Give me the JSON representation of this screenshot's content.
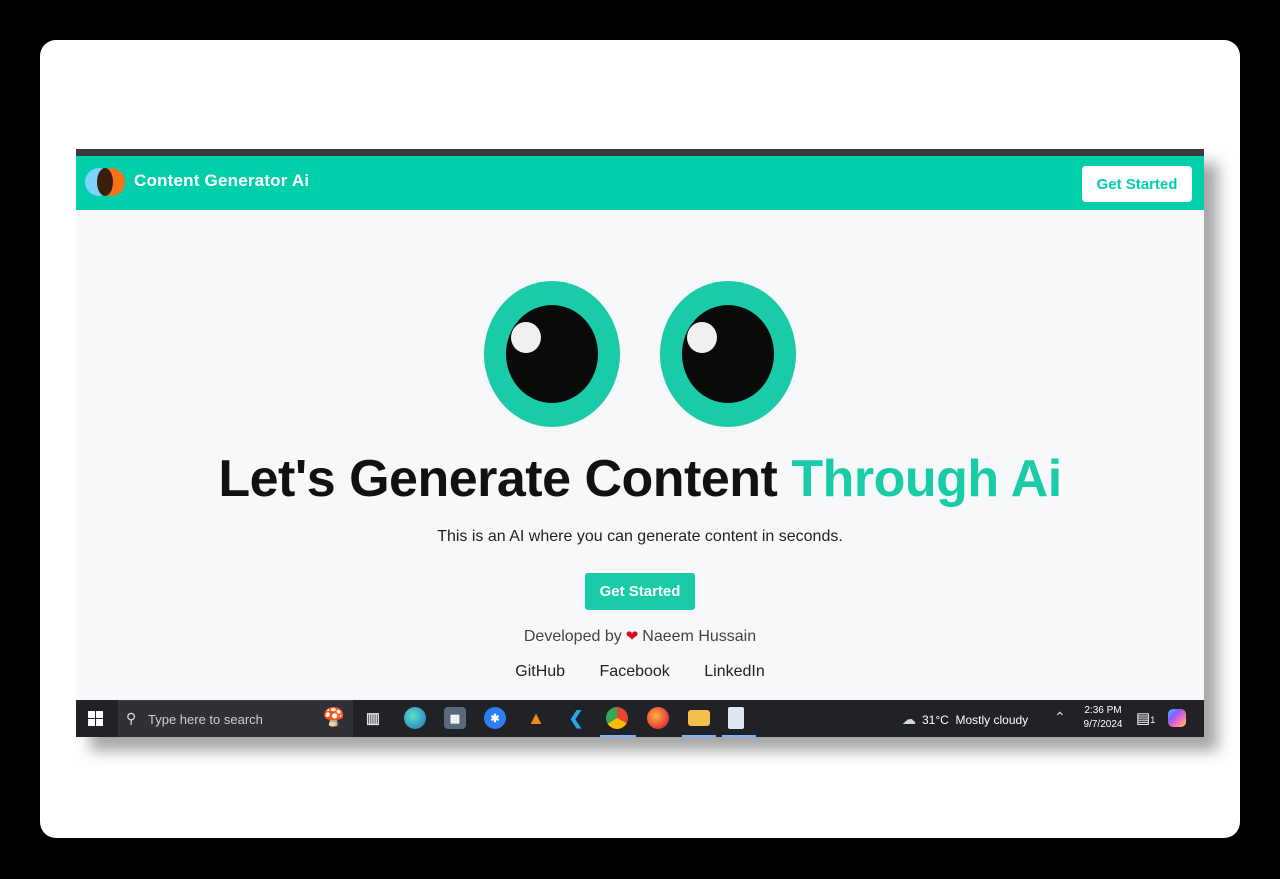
{
  "navbar": {
    "brand": "Content Generator Ai",
    "cta_label": "Get Started"
  },
  "hero": {
    "headline_main": "Let's Generate Content ",
    "headline_accent": "Through Ai",
    "subtitle": "This is an AI where you can generate content in seconds.",
    "cta_label": "Get Started"
  },
  "developer": {
    "prefix": "Developed by",
    "name": "Naeem Hussain"
  },
  "links": [
    {
      "label": "GitHub"
    },
    {
      "label": "Facebook"
    },
    {
      "label": "LinkedIn"
    }
  ],
  "taskbar": {
    "search_placeholder": "Type here to search",
    "apps": [
      "task-view",
      "edge",
      "calculator",
      "network",
      "vlc",
      "vscode",
      "chrome",
      "firefox",
      "file-explorer",
      "notepad"
    ],
    "weather": {
      "temperature": "31°C",
      "condition": "Mostly cloudy"
    },
    "time": "2:36 PM",
    "date": "9/7/2024",
    "notification_count": "1"
  },
  "colors": {
    "accent": "#00cfaa",
    "eye": "#19cba6",
    "background": "#f7f8fa",
    "text": "#111111"
  }
}
